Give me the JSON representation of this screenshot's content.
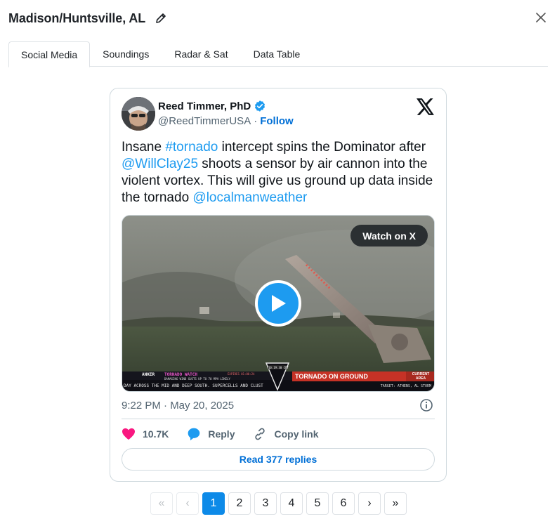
{
  "header": {
    "title": "Madison/Huntsville, AL",
    "edit_icon": "pencil-icon",
    "close_icon": "close-icon"
  },
  "tabs": [
    {
      "label": "Social Media",
      "active": true
    },
    {
      "label": "Soundings",
      "active": false
    },
    {
      "label": "Radar & Sat",
      "active": false
    },
    {
      "label": "Data Table",
      "active": false
    }
  ],
  "tweet": {
    "author_name": "Reed Timmer, PhD",
    "handle": "@ReedTimmerUSA",
    "separator": "·",
    "follow_label": "Follow",
    "text": {
      "p1": "Insane ",
      "hashtag": "#tornado",
      "p2": " intercept spins the Dominator after ",
      "mention1": "@WillClay25",
      "p3": " shoots a sensor by air cannon into the violent vortex. This will give us ground up data inside the tornado ",
      "mention2": "@localmanweather"
    },
    "media": {
      "watch_label": "Watch on X",
      "ticker": {
        "brand": "ANKER",
        "watch": "TORNADO WATCH",
        "watch_detail": "DAMAGING WIND GUSTS UP TO 70 MPH LIKELY",
        "expires": "EXPIRES 01:00:24",
        "headline": "TORNADO ON GROUND",
        "tag": "CURRENT AREA",
        "crawl": "DAY ACROSS THE MID AND DEEP SOUTH. SUPERCELLS AND CLUST",
        "time": "10:19:30 CDT",
        "target": "TARGET: ATHENS, AL STORM"
      }
    },
    "timestamp": "9:22 PM · May 20, 2025",
    "likes": "10.7K",
    "reply_label": "Reply",
    "copy_label": "Copy link",
    "read_replies": "Read 377 replies",
    "accent": "#1d9bf0",
    "like_color": "#f91880"
  },
  "pagination": {
    "first": "«",
    "prev": "‹",
    "pages": [
      "1",
      "2",
      "3",
      "4",
      "5",
      "6"
    ],
    "current": "1",
    "next": "›",
    "last": "»",
    "active_color": "#0d8ae8"
  }
}
